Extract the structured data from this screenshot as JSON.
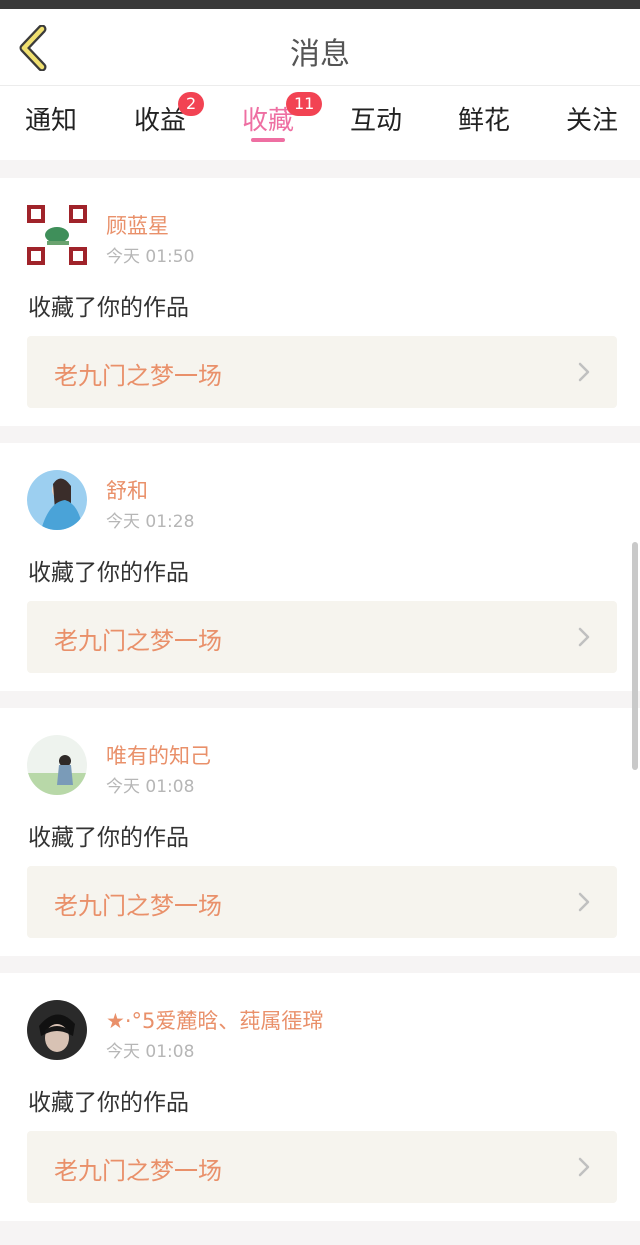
{
  "header": {
    "title": "消息",
    "back_icon": "chevron-left-icon"
  },
  "tabs": [
    {
      "label": "通知",
      "badge": null,
      "active": false
    },
    {
      "label": "收益",
      "badge": "2",
      "active": false
    },
    {
      "label": "收藏",
      "badge": "11",
      "active": true
    },
    {
      "label": "互动",
      "badge": null,
      "active": false
    },
    {
      "label": "鲜花",
      "badge": null,
      "active": false
    },
    {
      "label": "关注",
      "badge": null,
      "active": false
    }
  ],
  "messages": [
    {
      "user": "顾蓝星",
      "time": "今天 01:50",
      "action": "收藏了你的作品",
      "work": "老九门之梦一场"
    },
    {
      "user": "舒和",
      "time": "今天 01:28",
      "action": "收藏了你的作品",
      "work": "老九门之梦一场"
    },
    {
      "user": "唯有的知己",
      "time": "今天 01:08",
      "action": "收藏了你的作品",
      "work": "老九门之梦一场"
    },
    {
      "user": "★·°5爱麓晗、莼属徰瑺",
      "time": "今天 01:08",
      "action": "收藏了你的作品",
      "work": "老九门之梦一场"
    }
  ],
  "colors": {
    "accent": "#ee6fa2",
    "username": "#e9906a",
    "badge": "#f24353",
    "back_icon": "#f0e070"
  }
}
